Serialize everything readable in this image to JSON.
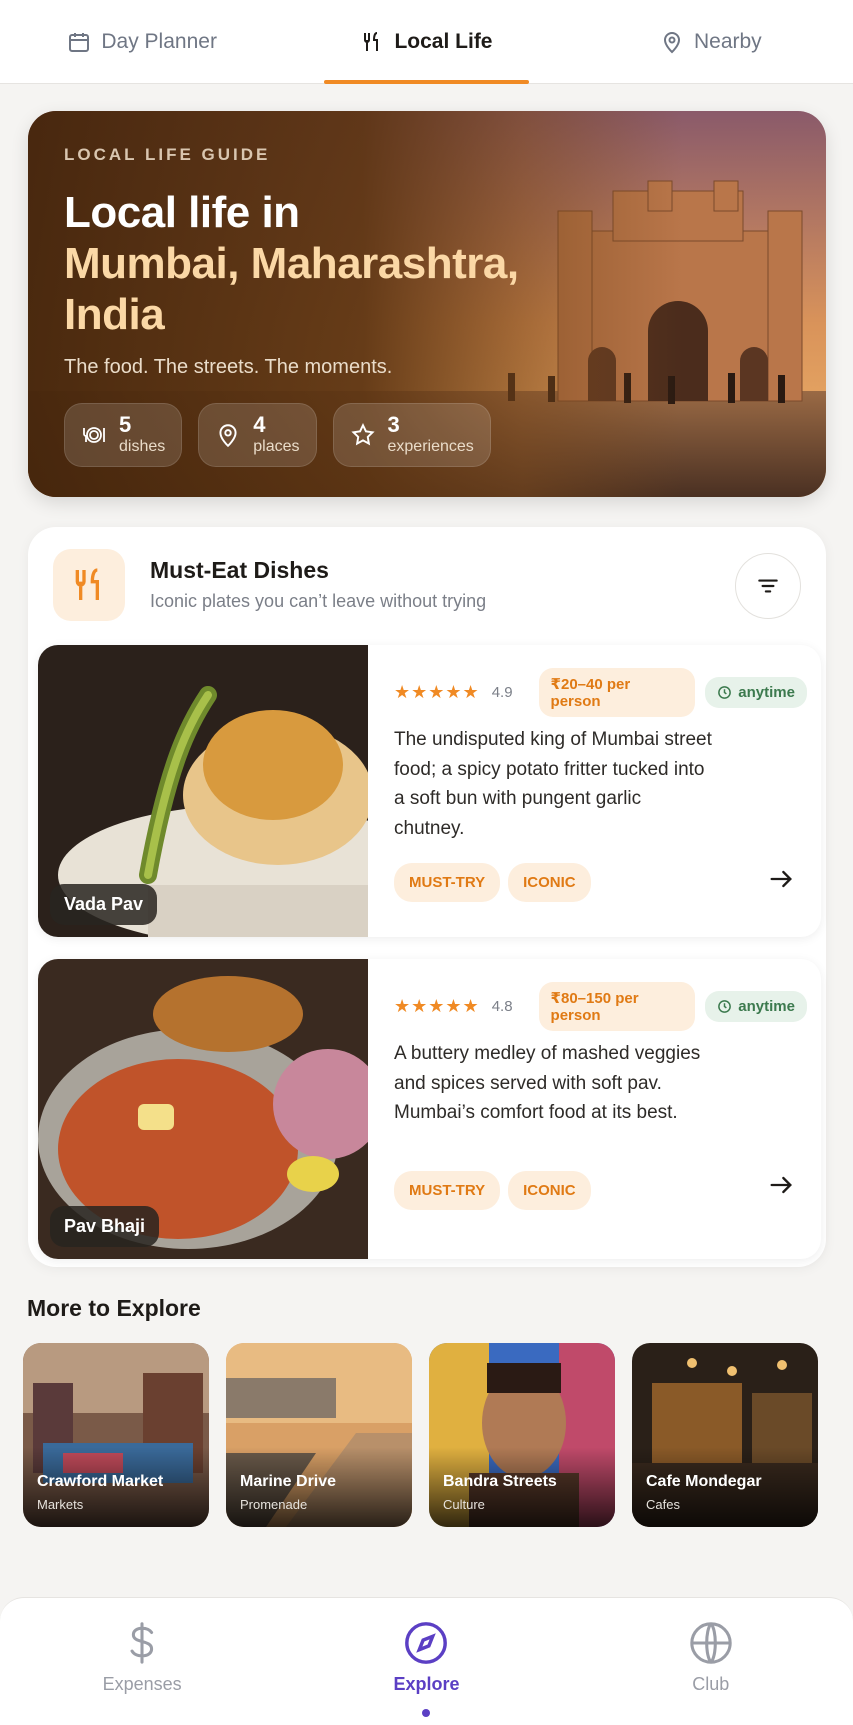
{
  "top_tabs": [
    {
      "label": "Day Planner",
      "icon": "calendar-icon",
      "active": false
    },
    {
      "label": "Local Life",
      "icon": "utensils-icon",
      "active": true
    },
    {
      "label": "Nearby",
      "icon": "map-pin-icon",
      "active": false
    }
  ],
  "hero": {
    "kicker": "LOCAL LIFE GUIDE",
    "title_line1": "Local life in",
    "title_line2": "Mumbai, Maharashtra,",
    "title_line3": "India",
    "subtitle": "The food. The streets. The moments.",
    "stats": [
      {
        "num": "5",
        "label": "dishes",
        "icon": "plate-icon"
      },
      {
        "num": "4",
        "label": "places",
        "icon": "map-pin-icon"
      },
      {
        "num": "3",
        "label": "experiences",
        "icon": "star-icon"
      }
    ]
  },
  "must_eat": {
    "title": "Must-Eat Dishes",
    "subtitle": "Iconic plates you can’t leave without trying",
    "dishes": [
      {
        "name": "Vada Pav",
        "stars": "★★★★★",
        "rating": "4.9",
        "price": "₹20–40 per person",
        "time": "anytime",
        "description": "The undisputed king of Mumbai street food; a spicy potato fritter tucked into a soft bun with pungent garlic chutney.",
        "tags": [
          "MUST-TRY",
          "ICONIC"
        ]
      },
      {
        "name": "Pav Bhaji",
        "stars": "★★★★★",
        "rating": "4.8",
        "price": "₹80–150 per person",
        "time": "anytime",
        "description": "A buttery medley of mashed veggies and spices served with soft pav. Mumbai’s comfort food at its best.",
        "tags": [
          "MUST-TRY",
          "ICONIC"
        ]
      }
    ]
  },
  "more": {
    "title": "More to Explore",
    "items": [
      {
        "name": "Crawford Market",
        "category": "Markets"
      },
      {
        "name": "Marine Drive",
        "category": "Promenade"
      },
      {
        "name": "Bandra Streets",
        "category": "Culture"
      },
      {
        "name": "Cafe Mondegar",
        "category": "Cafes"
      }
    ]
  },
  "bottom_nav": [
    {
      "label": "Expenses",
      "icon": "dollar-icon",
      "active": false
    },
    {
      "label": "Explore",
      "icon": "compass-icon",
      "active": true
    },
    {
      "label": "Club",
      "icon": "globe-icon",
      "active": false
    }
  ],
  "colors": {
    "accent": "#f08a24",
    "brand_purple": "#5b3fc4",
    "hero_brown": "#5c3412"
  }
}
